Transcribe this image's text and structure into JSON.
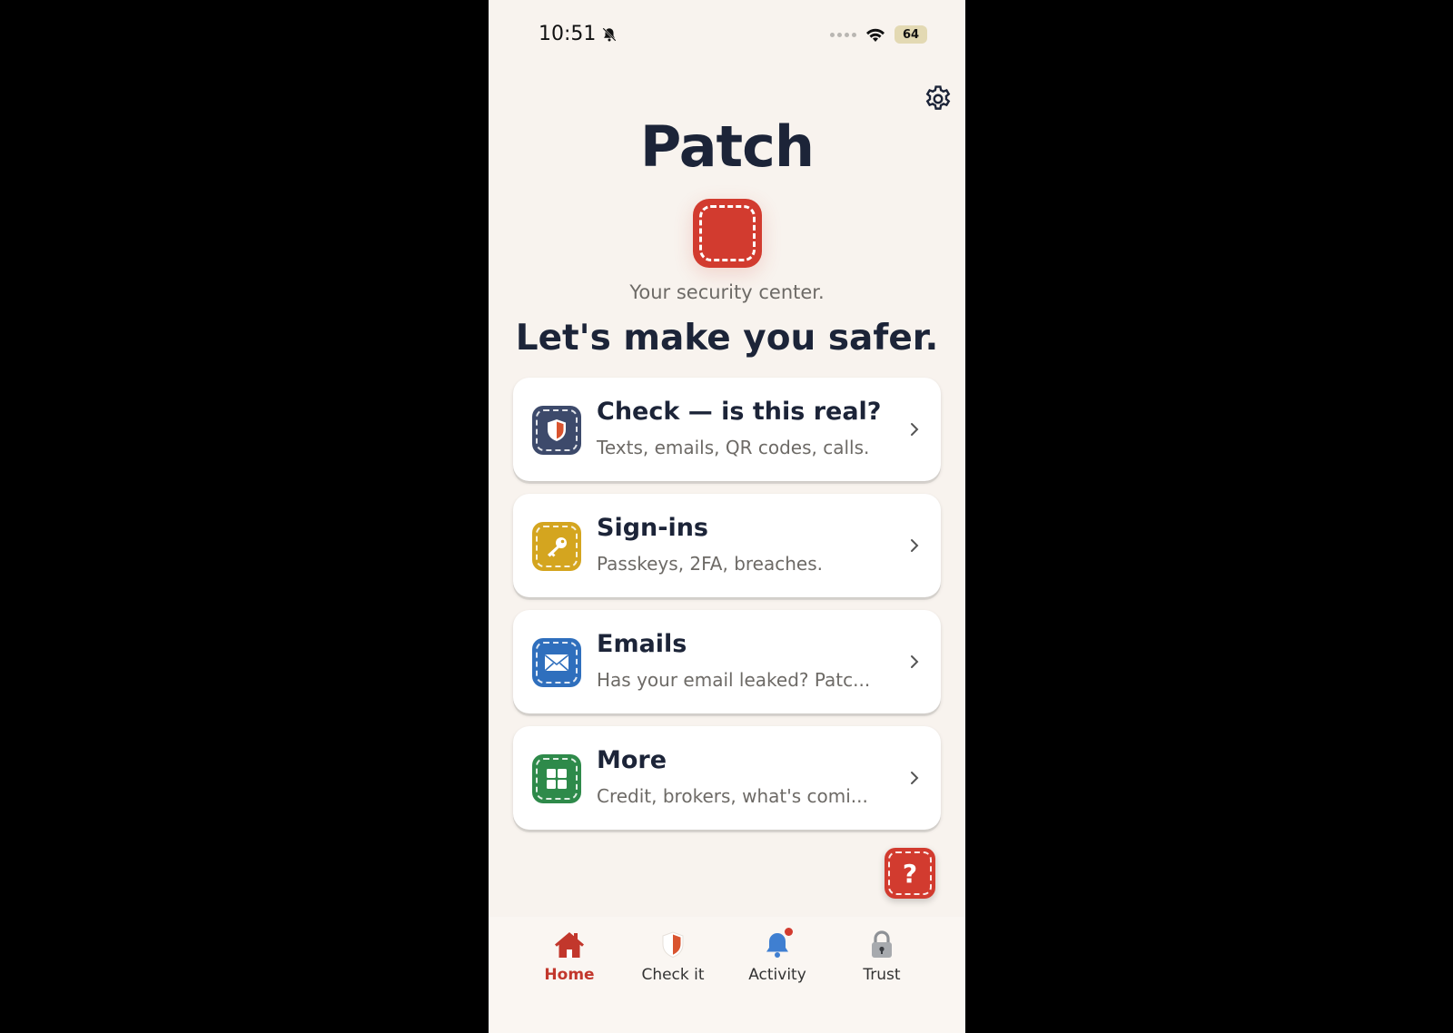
{
  "status_bar": {
    "time": "10:51",
    "battery": "64"
  },
  "header": {
    "app_title": "Patch",
    "subtitle": "Your security center.",
    "headline": "Let's make you safer."
  },
  "cards": [
    {
      "title": "Check — is this real?",
      "subtitle": "Texts, emails, QR codes, calls.",
      "icon": "shield-icon",
      "color": "#3d4a6b"
    },
    {
      "title": "Sign-ins",
      "subtitle": "Passkeys, 2FA, breaches.",
      "icon": "key-icon",
      "color": "#d4a51f"
    },
    {
      "title": "Emails",
      "subtitle": "Has your email leaked? Patc...",
      "icon": "envelope-icon",
      "color": "#2f6fbd"
    },
    {
      "title": "More",
      "subtitle": "Credit, brokers, what's comi...",
      "icon": "grid-icon",
      "color": "#2e8a4a"
    }
  ],
  "help_button": {
    "label": "?"
  },
  "tabs": [
    {
      "label": "Home",
      "icon": "home-icon",
      "active": true
    },
    {
      "label": "Check it",
      "icon": "shield-icon",
      "active": false
    },
    {
      "label": "Activity",
      "icon": "bell-icon",
      "active": false
    },
    {
      "label": "Trust",
      "icon": "padlock-icon",
      "active": false
    }
  ],
  "colors": {
    "accent": "#d23b2f",
    "text_dark": "#1c2438",
    "background": "#f8f3ee"
  }
}
